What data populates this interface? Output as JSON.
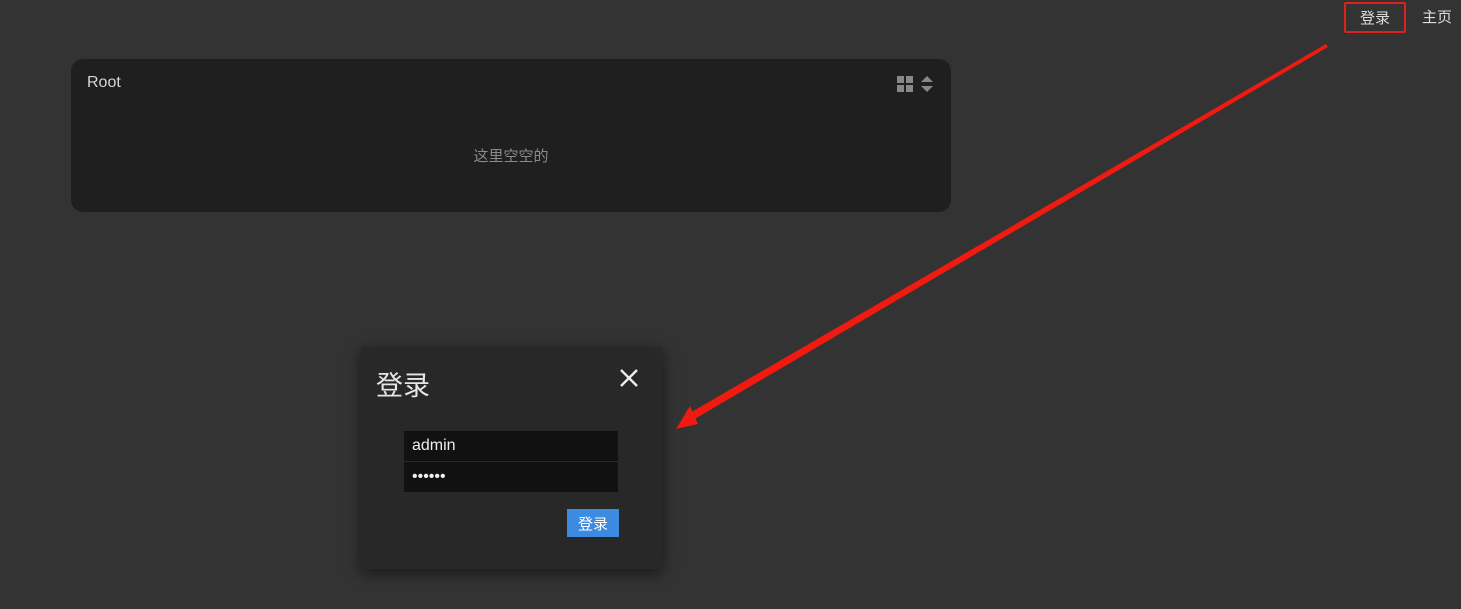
{
  "nav": {
    "login_label": "登录",
    "home_label": "主页"
  },
  "root_panel": {
    "title": "Root",
    "empty_text": "这里空空的",
    "view_icon": "grid-view-icon",
    "sort_icon": "sort-icon"
  },
  "login_dialog": {
    "title": "登录",
    "username_value": "admin",
    "password_value": "••••••",
    "submit_label": "登录",
    "close_icon": "close-icon"
  },
  "annotation": {
    "highlight_color": "#e0201a",
    "arrow_color": "#f01a10"
  },
  "colors": {
    "background": "#333333",
    "panel": "#1f1f1f",
    "dialog": "#282828",
    "accent": "#3d8be0"
  }
}
